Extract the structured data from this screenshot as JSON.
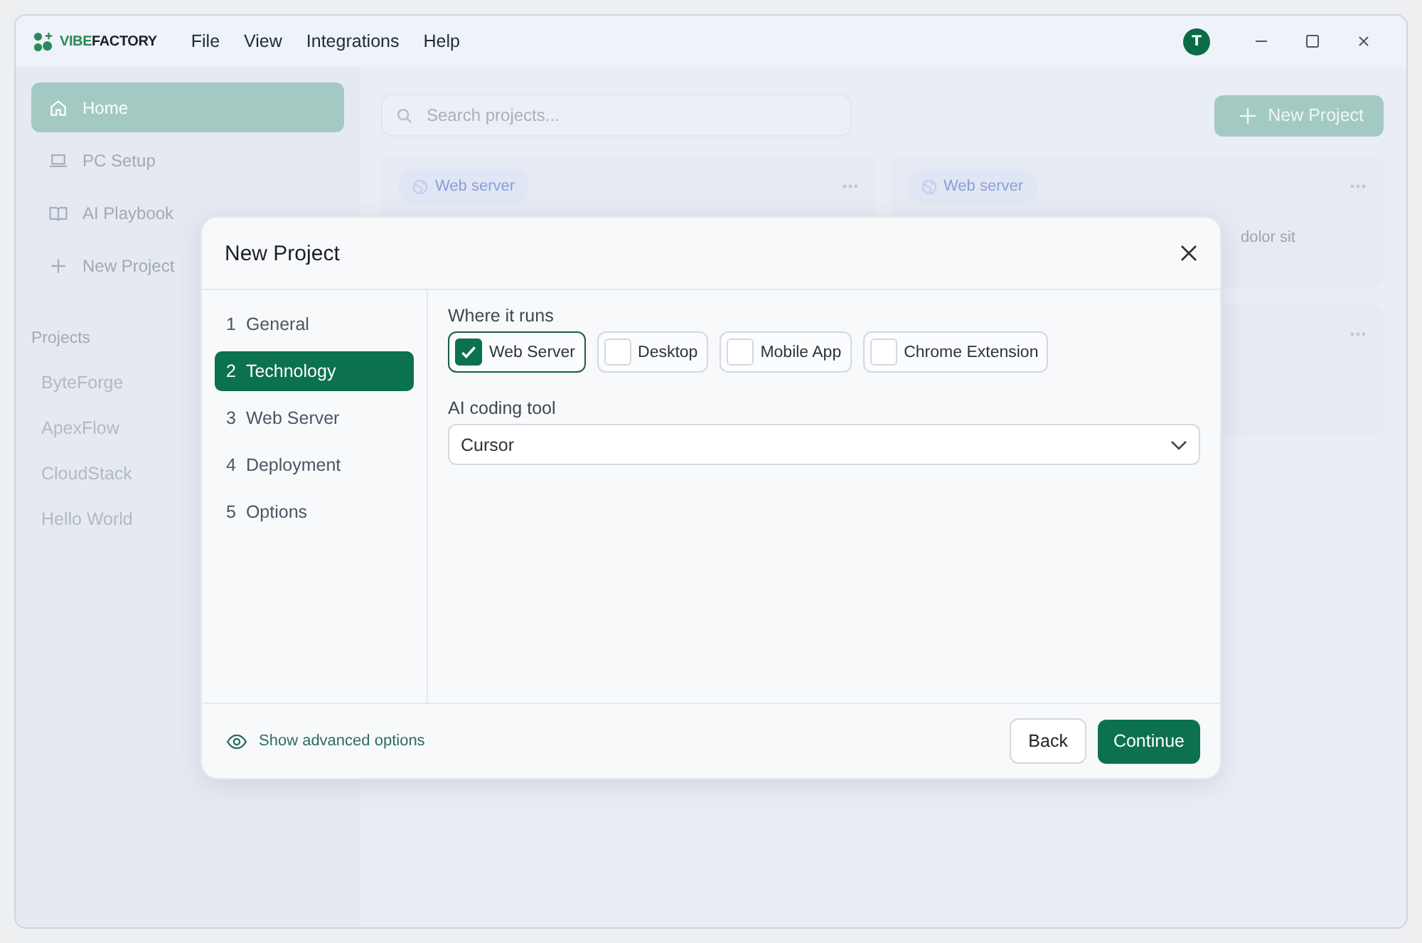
{
  "app": {
    "logo": {
      "part1": "VIBE",
      "part2": "FACTORY"
    },
    "menu": [
      "File",
      "View",
      "Integrations",
      "Help"
    ],
    "avatar": "T"
  },
  "sidebar": {
    "nav": [
      {
        "label": "Home",
        "kind": "home",
        "selected": true
      },
      {
        "label": "PC Setup",
        "kind": "laptop",
        "selected": false
      },
      {
        "label": "AI Playbook",
        "kind": "book",
        "selected": false
      },
      {
        "label": "New Project",
        "kind": "plus",
        "selected": false
      }
    ],
    "section_title": "Projects",
    "projects": [
      "ByteForge",
      "ApexFlow",
      "CloudStack",
      "Hello World"
    ]
  },
  "main": {
    "search": {
      "placeholder": "Search projects..."
    },
    "new_button": "New Project",
    "columns": [
      [
        {
          "tag": "Web server"
        }
      ],
      [
        {
          "tag": "Web server",
          "snippet": "dolor sit"
        },
        {}
      ]
    ]
  },
  "dialog": {
    "title": "New Project",
    "steps": [
      {
        "number": "1",
        "label": "General",
        "selected": false
      },
      {
        "number": "2",
        "label": "Technology",
        "selected": true
      },
      {
        "number": "3",
        "label": "Web Server",
        "selected": false
      },
      {
        "number": "4",
        "label": "Deployment",
        "selected": false
      },
      {
        "number": "5",
        "label": "Options",
        "selected": false
      }
    ],
    "platform_label": "Where it runs",
    "platforms": [
      {
        "label": "Web Server",
        "checked": true
      },
      {
        "label": "Desktop",
        "checked": false
      },
      {
        "label": "Mobile App",
        "checked": false
      },
      {
        "label": "Chrome Extension",
        "checked": false
      }
    ],
    "tool_label": "AI coding tool",
    "tool_value": "Cursor",
    "advanced_link": "Show advanced options",
    "back": "Back",
    "continue": "Continue"
  }
}
